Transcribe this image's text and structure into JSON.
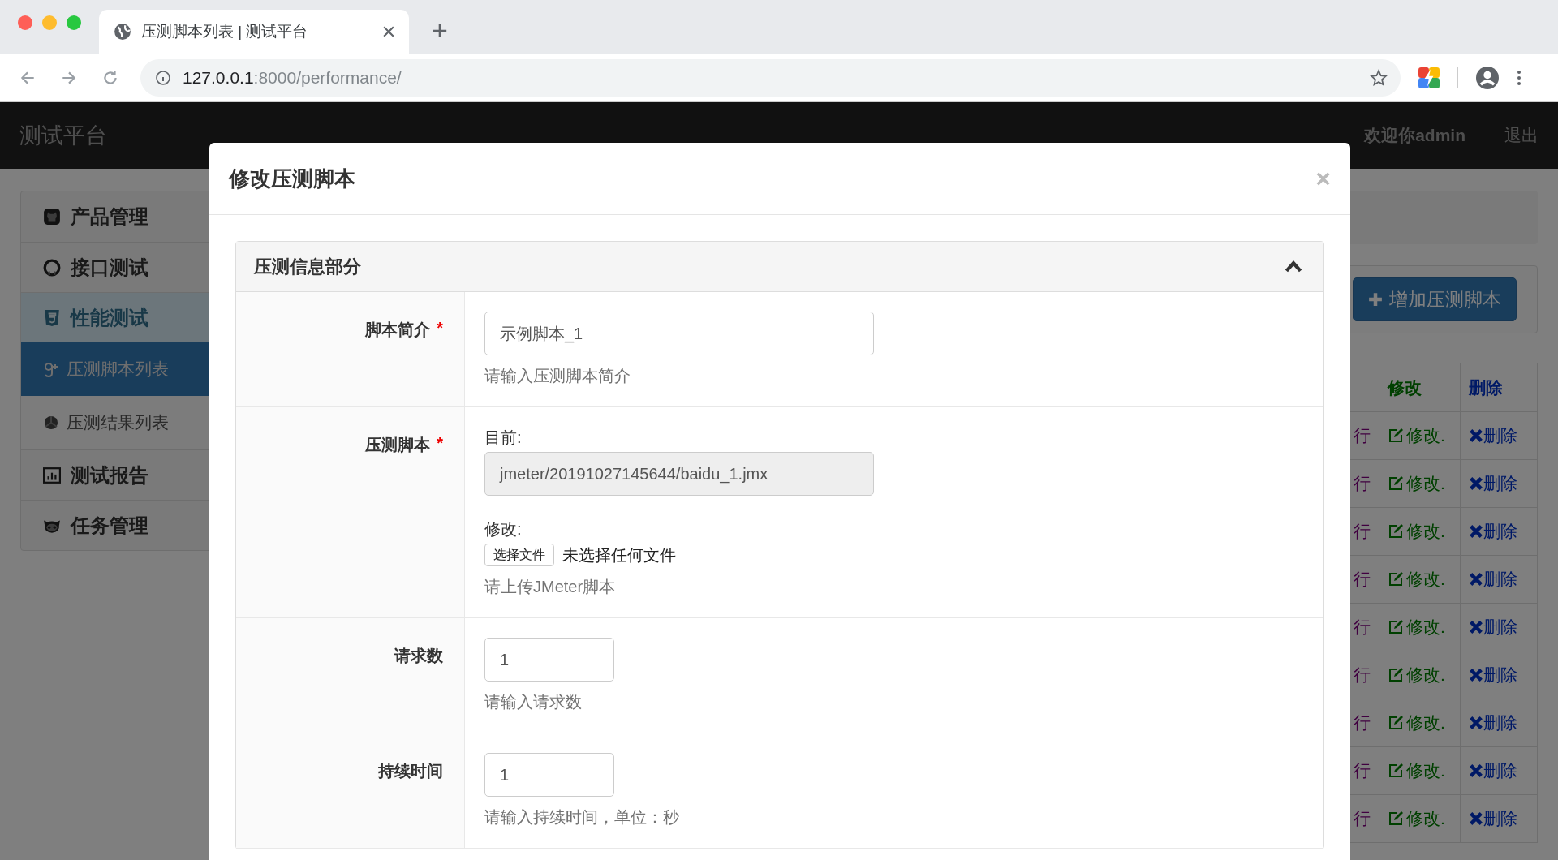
{
  "browser": {
    "tab_title": "压测脚本列表 | 测试平台",
    "new_tab": "+",
    "url_host": "127.0.0.1",
    "url_rest": ":8000/performance/"
  },
  "navbar": {
    "brand": "测试平台",
    "welcome": "欢迎你admin",
    "logout": "退出"
  },
  "sidebar": {
    "items": [
      {
        "label": "产品管理",
        "expanded": false
      },
      {
        "label": "接口测试",
        "expanded": false
      },
      {
        "label": "性能测试",
        "expanded": true,
        "children": [
          {
            "label": "压测脚本列表",
            "selected": true
          },
          {
            "label": "压测结果列表",
            "selected": false
          }
        ]
      },
      {
        "label": "测试报告",
        "expanded": false
      },
      {
        "label": "任务管理",
        "expanded": false
      }
    ]
  },
  "toolbar": {
    "add_button": "增加压测脚本"
  },
  "table": {
    "columns": [
      "",
      "修改",
      "删除"
    ],
    "rows": [
      {
        "column_1": "行",
        "edit": "修改.",
        "delete": "删除"
      },
      {
        "column_1": "行",
        "edit": "修改.",
        "delete": "删除"
      },
      {
        "column_1": "行",
        "edit": "修改.",
        "delete": "删除"
      },
      {
        "column_1": "行",
        "edit": "修改.",
        "delete": "删除"
      },
      {
        "column_1": "行",
        "edit": "修改.",
        "delete": "删除"
      },
      {
        "column_1": "行",
        "edit": "修改.",
        "delete": "删除"
      },
      {
        "column_1": "行",
        "edit": "修改.",
        "delete": "删除"
      },
      {
        "column_1": "行",
        "edit": "修改.",
        "delete": "删除"
      },
      {
        "column_1": "行",
        "edit": "修改.",
        "delete": "删除"
      }
    ]
  },
  "modal": {
    "title": "修改压测脚本",
    "close": "×",
    "panel": {
      "title": "压测信息部分",
      "expanded": true,
      "fields": [
        {
          "kind": "text",
          "label": "脚本简介",
          "required_mark": "*",
          "value": "示例脚本_1",
          "help": "请输入压测脚本简介"
        },
        {
          "kind": "file",
          "label": "压测脚本",
          "required_mark": "*",
          "current_label": "目前:",
          "current_value": "jmeter/20191027145644/baidu_1.jmx",
          "change_label": "修改:",
          "button": "选择文件",
          "no_file": "未选择任何文件",
          "help": "请上传JMeter脚本"
        },
        {
          "kind": "short",
          "label": "请求数",
          "value": "1",
          "help": "请输入请求数"
        },
        {
          "kind": "short",
          "label": "持续时间",
          "value": "1",
          "help": "请输入持续时间，单位：秒"
        }
      ]
    }
  }
}
